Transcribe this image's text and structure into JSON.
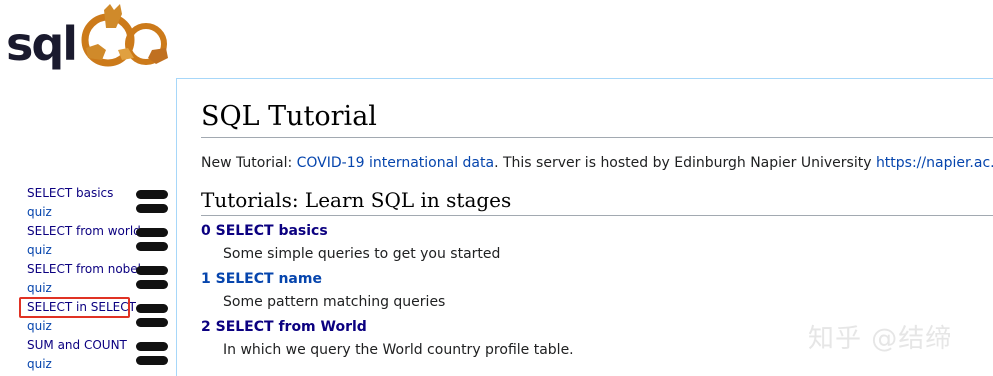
{
  "logo": {
    "text": "sqlzoo"
  },
  "sidebar": {
    "items": [
      {
        "label": "SELECT basics"
      },
      {
        "label": "quiz"
      },
      {
        "label": "SELECT from world"
      },
      {
        "label": "quiz"
      },
      {
        "label": "SELECT from nobel"
      },
      {
        "label": "quiz"
      },
      {
        "label": "SELECT in SELECT",
        "selected": true
      },
      {
        "label": "quiz"
      },
      {
        "label": "SUM and COUNT"
      },
      {
        "label": "quiz"
      }
    ],
    "highlight_color": "#e03224"
  },
  "page": {
    "title": "SQL Tutorial",
    "intro_prefix": "New Tutorial: ",
    "intro_link": "COVID-19 international data",
    "intro_middle": ". This server is hosted by Edinburgh Napier University ",
    "intro_url": "https://napier.ac.uk",
    "section_title": "Tutorials: Learn SQL in stages",
    "tutorials": [
      {
        "title": "0 SELECT basics",
        "description": "Some simple queries to get you started"
      },
      {
        "title": "1 SELECT name",
        "description": "Some pattern matching queries"
      },
      {
        "title": "2 SELECT from World",
        "description": "In which we query the World country profile table."
      }
    ]
  },
  "watermark": "知乎 @结缔",
  "colors": {
    "link": "#0645ad",
    "visited": "#0b0080",
    "border": "#a7d7f9"
  }
}
